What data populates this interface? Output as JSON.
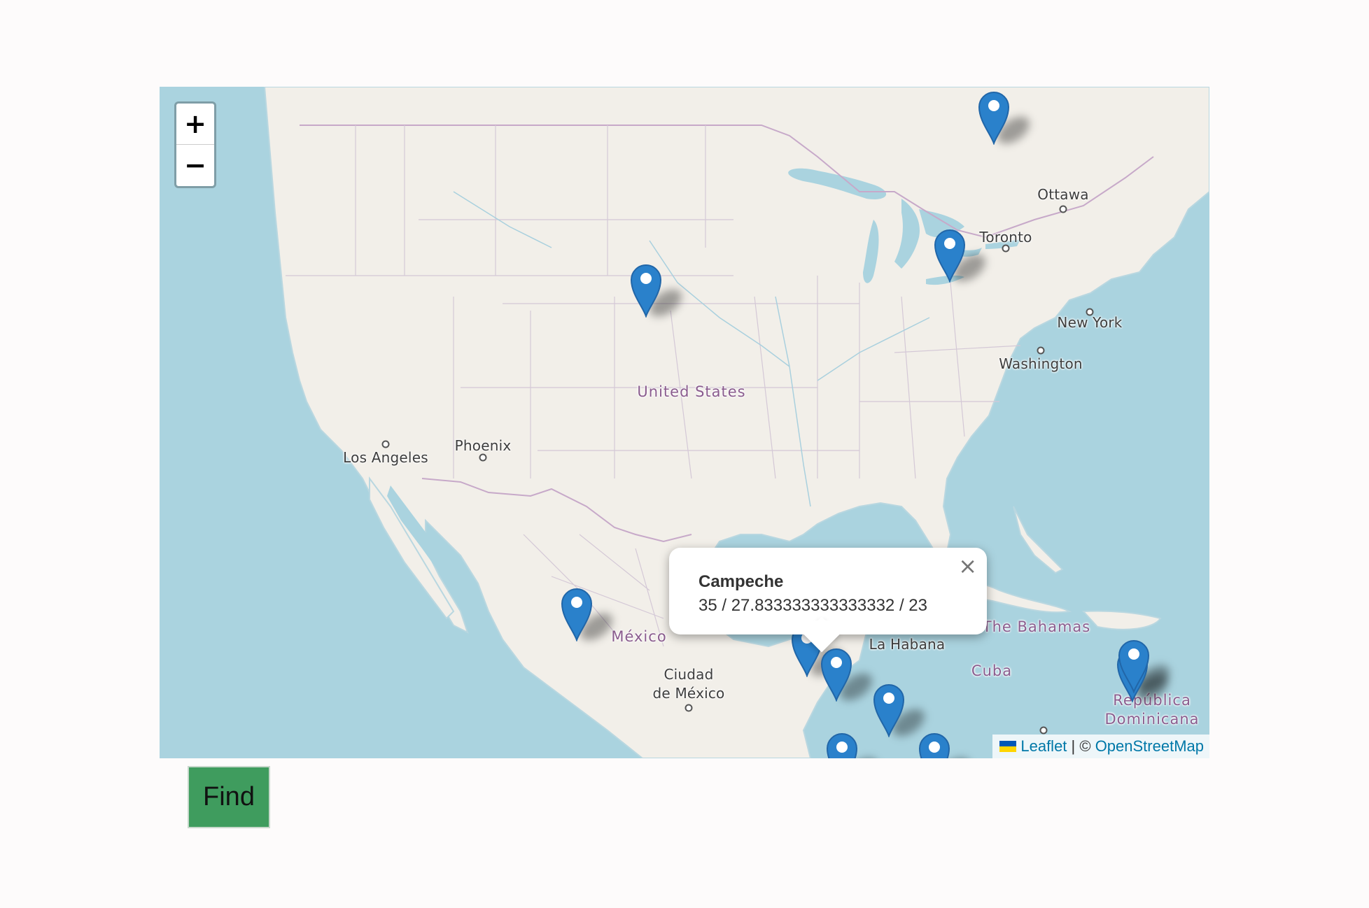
{
  "map": {
    "zoom_in_label": "+",
    "zoom_out_label": "−",
    "labels": {
      "ottawa": "Ottawa",
      "toronto": "Toronto",
      "new_york": "New York",
      "washington": "Washington",
      "united_states": "United States",
      "phoenix": "Phoenix",
      "los_angeles": "Los Angeles",
      "mexico": "México",
      "ciudad_de_mexico_1": "Ciudad",
      "ciudad_de_mexico_2": "de México",
      "la_habana": "La Habana",
      "bahamas": "The Bahamas",
      "cuba": "Cuba",
      "republica_1": "República",
      "republica_2": "Dominicana"
    },
    "popup": {
      "title": "Campeche",
      "values": "35 / 27.833333333333332 / 23",
      "close_label": "×"
    },
    "attribution": {
      "leaflet": "Leaflet",
      "separator": " | © ",
      "osm": "OpenStreetMap"
    },
    "colors": {
      "water": "#aad3df",
      "land": "#f2efe9",
      "marker": "#2a81cb",
      "border": "#c7a9c9"
    }
  },
  "find_button_label": "Find"
}
